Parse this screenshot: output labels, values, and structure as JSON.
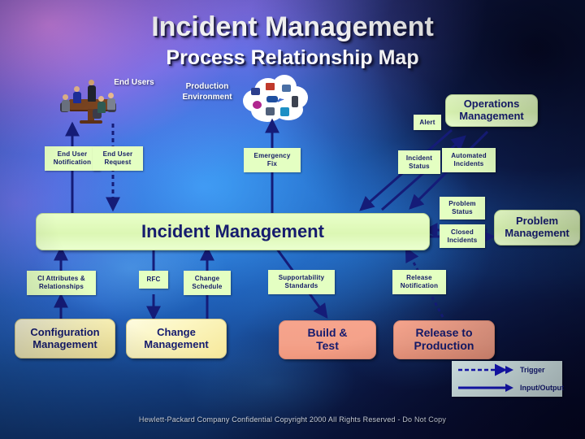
{
  "slide": {
    "title_main": "Incident Management",
    "title_sub": "Process Relationship Map",
    "footer": "Hewlett-Packard Company Confidential Copyright 2000 All Rights Reserved - Do Not Copy"
  },
  "colors": {
    "process_box_fill": "#dcf7b4",
    "config_box_fill": "#f6e89a",
    "salmon_box_fill": "#f4a189",
    "label_box_fill": "#e4ffc2",
    "text_navy": "#141a66",
    "arrow_navy": "#151c78",
    "legend_fill": "#eaffff",
    "title_white": "#ffffff"
  },
  "clipart": {
    "end_users_label": "End Users",
    "production_env_label": "Production\nEnvironment"
  },
  "processes": [
    {
      "id": "incident-management",
      "label": "Incident Management"
    },
    {
      "id": "operations-management",
      "label": "Operations\nManagement"
    },
    {
      "id": "problem-management",
      "label": "Problem\nManagement"
    },
    {
      "id": "configuration-management",
      "label": "Configuration\nManagement"
    },
    {
      "id": "change-management",
      "label": "Change\nManagement"
    },
    {
      "id": "build-test",
      "label": "Build &\nTest"
    },
    {
      "id": "release-to-production",
      "label": "Release to\nProduction"
    }
  ],
  "flow_labels": [
    {
      "id": "end-user-notification",
      "label": "End User\nNotification"
    },
    {
      "id": "end-user-request",
      "label": "End User\nRequest"
    },
    {
      "id": "emergency-fix",
      "label": "Emergency\nFix"
    },
    {
      "id": "alert",
      "label": "Alert"
    },
    {
      "id": "incident-status",
      "label": "Incident\nStatus"
    },
    {
      "id": "automated-incidents",
      "label": "Automated\nIncidents"
    },
    {
      "id": "problem-status",
      "label": "Problem\nStatus"
    },
    {
      "id": "closed-incidents",
      "label": "Closed\nIncidents"
    },
    {
      "id": "ci-attributes-relationships",
      "label": "CI Attributes &\nRelationships"
    },
    {
      "id": "rfc",
      "label": "RFC"
    },
    {
      "id": "change-schedule",
      "label": "Change\nSchedule"
    },
    {
      "id": "supportability-standards",
      "label": "Supportability\nStandards"
    },
    {
      "id": "release-notification",
      "label": "Release\nNotification"
    }
  ],
  "legend": {
    "trigger_label": "Trigger",
    "input_output_label": "Input/Output"
  }
}
